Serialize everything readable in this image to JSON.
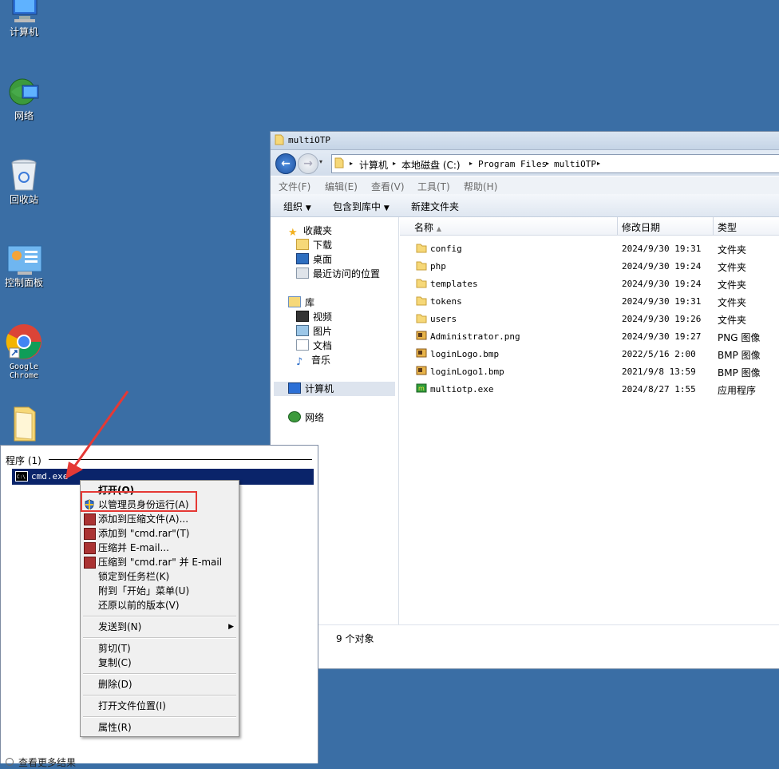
{
  "desktop": {
    "icons": [
      {
        "label": "计算机"
      },
      {
        "label": "网络"
      },
      {
        "label": "回收站"
      },
      {
        "label": "控制面板"
      },
      {
        "label": "Google\nChrome"
      },
      {
        "label": ""
      }
    ]
  },
  "explorer": {
    "title": "multiOTP",
    "breadcrumbs": [
      "计算机",
      "本地磁盘 (C:)",
      "Program Files",
      "multiOTP"
    ],
    "menu": [
      "文件(F)",
      "编辑(E)",
      "查看(V)",
      "工具(T)",
      "帮助(H)"
    ],
    "commands": [
      "组织",
      "包含到库中",
      "新建文件夹"
    ],
    "nav": {
      "favorites": "收藏夹",
      "downloads": "下载",
      "desktop": "桌面",
      "recent": "最近访问的位置",
      "libraries": "库",
      "videos": "视频",
      "pictures": "图片",
      "documents": "文档",
      "music": "音乐",
      "computer": "计算机",
      "network": "网络"
    },
    "columns": {
      "name": "名称",
      "date": "修改日期",
      "type": "类型"
    },
    "files": [
      {
        "name": "config",
        "date": "2024/9/30 19:31",
        "type": "文件夹",
        "icon": "folder-icon"
      },
      {
        "name": "php",
        "date": "2024/9/30 19:24",
        "type": "文件夹",
        "icon": "folder-icon"
      },
      {
        "name": "templates",
        "date": "2024/9/30 19:24",
        "type": "文件夹",
        "icon": "folder-icon"
      },
      {
        "name": "tokens",
        "date": "2024/9/30 19:31",
        "type": "文件夹",
        "icon": "folder-icon"
      },
      {
        "name": "users",
        "date": "2024/9/30 19:26",
        "type": "文件夹",
        "icon": "folder-icon"
      },
      {
        "name": "Administrator.png",
        "date": "2024/9/30 19:27",
        "type": "PNG 图像",
        "icon": "image-icon"
      },
      {
        "name": "loginLogo.bmp",
        "date": "2022/5/16 2:00",
        "type": "BMP 图像",
        "icon": "image-icon"
      },
      {
        "name": "loginLogo1.bmp",
        "date": "2021/9/8 13:59",
        "type": "BMP 图像",
        "icon": "image-icon"
      },
      {
        "name": "multiotp.exe",
        "date": "2024/8/27 1:55",
        "type": "应用程序",
        "icon": "app-icon"
      }
    ],
    "status": "9 个对象"
  },
  "start_panel": {
    "section_header": "程序 (1)",
    "result": "cmd.exe",
    "more_results": "查看更多结果"
  },
  "context_menu": {
    "items": [
      "打开(O)",
      "以管理员身份运行(A)",
      "添加到压缩文件(A)...",
      "添加到 \"cmd.rar\"(T)",
      "压缩并 E-mail...",
      "压缩到 \"cmd.rar\" 并 E-mail",
      "锁定到任务栏(K)",
      "附到「开始」菜单(U)",
      "还原以前的版本(V)",
      "发送到(N)",
      "剪切(T)",
      "复制(C)",
      "删除(D)",
      "打开文件位置(I)",
      "属性(R)"
    ]
  },
  "colors": {
    "desktop": "#3a6ea5",
    "highlight_box": "#e53935",
    "arrow": "#e53935",
    "selection": "#0a246a"
  }
}
